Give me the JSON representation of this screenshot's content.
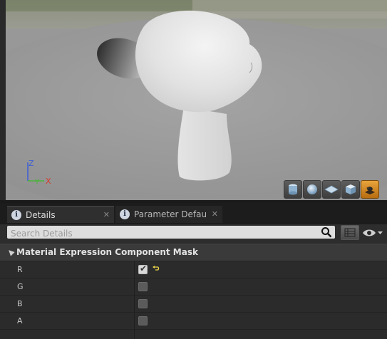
{
  "viewport": {
    "axis": {
      "z_label": "Z",
      "y_label": "Y",
      "x_label": "X"
    },
    "preview_buttons": [
      {
        "icon": "cylinder-icon",
        "active": false
      },
      {
        "icon": "sphere-icon",
        "active": false
      },
      {
        "icon": "plane-icon",
        "active": false
      },
      {
        "icon": "cube-icon",
        "active": false
      },
      {
        "icon": "custom-mesh-icon",
        "active": true
      }
    ]
  },
  "tabs": [
    {
      "label": "Details",
      "active": true
    },
    {
      "label": "Parameter Defaults",
      "active": false
    }
  ],
  "details": {
    "search_placeholder": "Search Details",
    "category": "Material Expression Component Mask",
    "properties": [
      {
        "name": "R",
        "checked": true,
        "modified": true
      },
      {
        "name": "G",
        "checked": false,
        "modified": false
      },
      {
        "name": "B",
        "checked": false,
        "modified": false
      },
      {
        "name": "A",
        "checked": false,
        "modified": false
      }
    ]
  },
  "colors": {
    "accent": "#e9a43c",
    "axis_x": "#d43b2f",
    "axis_y": "#4cb33b",
    "axis_z": "#3c5fd6"
  }
}
